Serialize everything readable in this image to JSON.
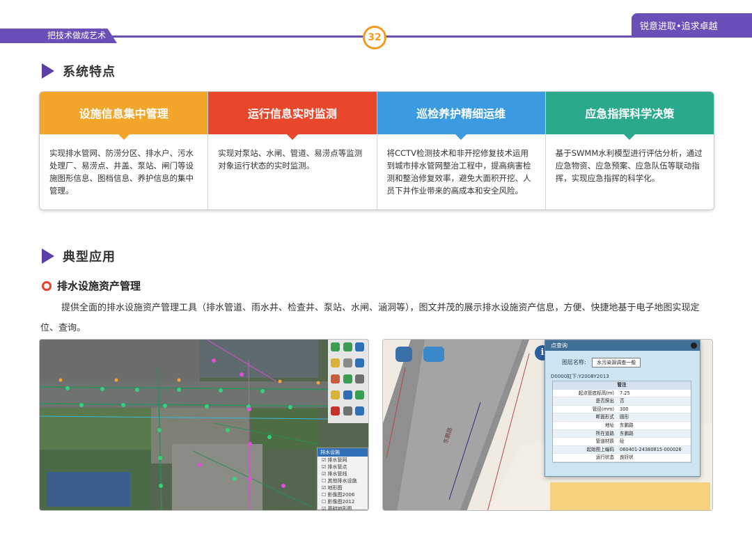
{
  "header": {
    "left_slogan": "把技术做成艺术",
    "right_slogan": "锐意进取•追求卓越",
    "page_number": "32"
  },
  "section1": {
    "title": "系统特点"
  },
  "features": [
    {
      "title": "设施信息集中管理",
      "color": "#f3a52a",
      "body": "实现排水管网、防涝分区、排水户、污水处理厂、易涝点、井盖、泵站、闸门等设施图形信息、图档信息、养护信息的集中管理。"
    },
    {
      "title": "运行信息实时监测",
      "color": "#e8472b",
      "body": "实现对泵站、水闸、管道、易涝点等监测对象运行状态的实时监测。"
    },
    {
      "title": "巡检养护精细运维",
      "color": "#3b9be0",
      "body": "将CCTV检测技术和非开挖修复技术运用到城市排水管网整治工程中，提高病害检测和整治修复效率，避免大面积开挖、人员下井作业带来的高成本和安全风险。"
    },
    {
      "title": "应急指挥科学决策",
      "color": "#2aa98d",
      "body": "基于SWMM水利模型进行评估分析，通过应急物资、应急预案、应急队伍等联动指挥，实现应急指挥的科学化。"
    }
  ],
  "section2": {
    "title": "典型应用"
  },
  "application": {
    "title": "排水设施资产管理",
    "description": "提供全面的排水设施资产管理工具（排水管道、雨水井、检查井、泵站、水闸、涵洞等），图文并茂的展示排水设施资产信息，方便、快捷地基于电子地图实现定位、查询。"
  },
  "screenshot_map": {
    "layer_panel": {
      "title": "排水设施",
      "rows": [
        "☑ 排水管网",
        "☑ 排水管点",
        "☑ 排水管线",
        "☐ 其他排水设施",
        "☑ 地形图",
        "☐ 影像图2006",
        "☐ 影像图2012",
        "☑ 基础地形图"
      ]
    }
  },
  "screenshot_query": {
    "window_title": "点查询",
    "layer_label": "图层名称:",
    "layer_value": "水污染源调查一般",
    "record_id": "D0000缸下:Y2008Y2013",
    "table_header": "管注",
    "rows": [
      {
        "k": "起点管底标高(m)",
        "v": "7.25"
      },
      {
        "k": "是否探出",
        "v": "否"
      },
      {
        "k": "管径(mm)",
        "v": "300"
      },
      {
        "k": "断面形式",
        "v": "圆形"
      },
      {
        "k": "地址",
        "v": "东鹏路"
      },
      {
        "k": "所在道路",
        "v": "东鹏路"
      },
      {
        "k": "管道材质",
        "v": "砼"
      },
      {
        "k": "起始图上编码",
        "v": "060401-24380815-000026"
      },
      {
        "k": "运行状态",
        "v": "良好状"
      }
    ],
    "road_label": "东鹏路"
  }
}
